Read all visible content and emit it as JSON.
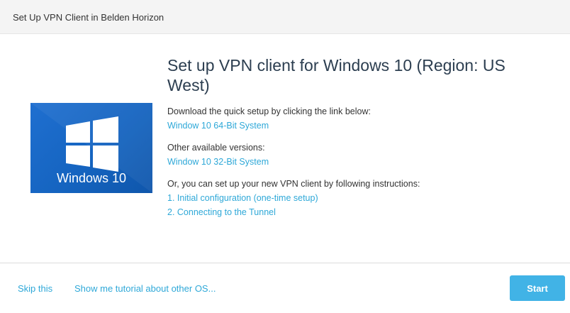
{
  "header": {
    "title": "Set Up VPN Client in Belden Horizon"
  },
  "os_logo": {
    "icon": "windows-logo",
    "text": "Windows 10",
    "color": "#1564c0"
  },
  "content": {
    "title": "Set up VPN client for Windows 10 (Region: US West)",
    "download_text": "Download the quick setup by clicking the link below:",
    "download_link": "Window 10 64-Bit System",
    "other_versions_text": "Other available versions:",
    "other_versions_link": "Window 10 32-Bit System",
    "instructions_text": "Or, you can set up your new VPN client by following instructions:",
    "instruction_links": [
      "1. Initial configuration (one-time setup)",
      "2. Connecting to the Tunnel"
    ]
  },
  "footer": {
    "skip_label": "Skip this",
    "tutorial_label": "Show me tutorial about other OS...",
    "start_label": "Start"
  },
  "colors": {
    "link": "#2ea8d8",
    "button": "#41b3e6",
    "title": "#2c3e50"
  }
}
